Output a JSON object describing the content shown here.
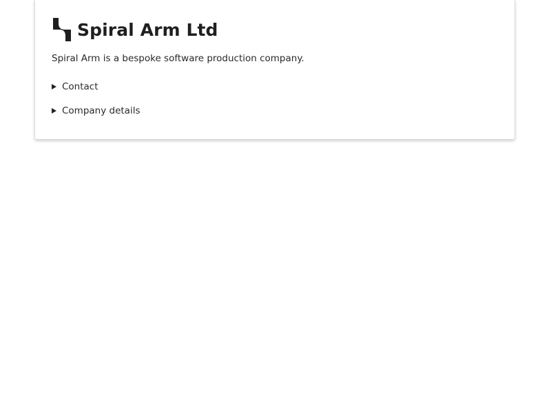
{
  "company": {
    "name": "Spiral Arm Ltd",
    "logo_icon": "spiral-arm-logo-icon",
    "tagline": "Spiral Arm is a bespoke software production company."
  },
  "sections": [
    {
      "label": "Contact",
      "icon": "triangle-right-icon",
      "expanded": false
    },
    {
      "label": "Company details",
      "icon": "triangle-right-icon",
      "expanded": false
    }
  ],
  "colors": {
    "text": "#222222",
    "card_border": "#dcdcdc",
    "background": "#ffffff"
  }
}
